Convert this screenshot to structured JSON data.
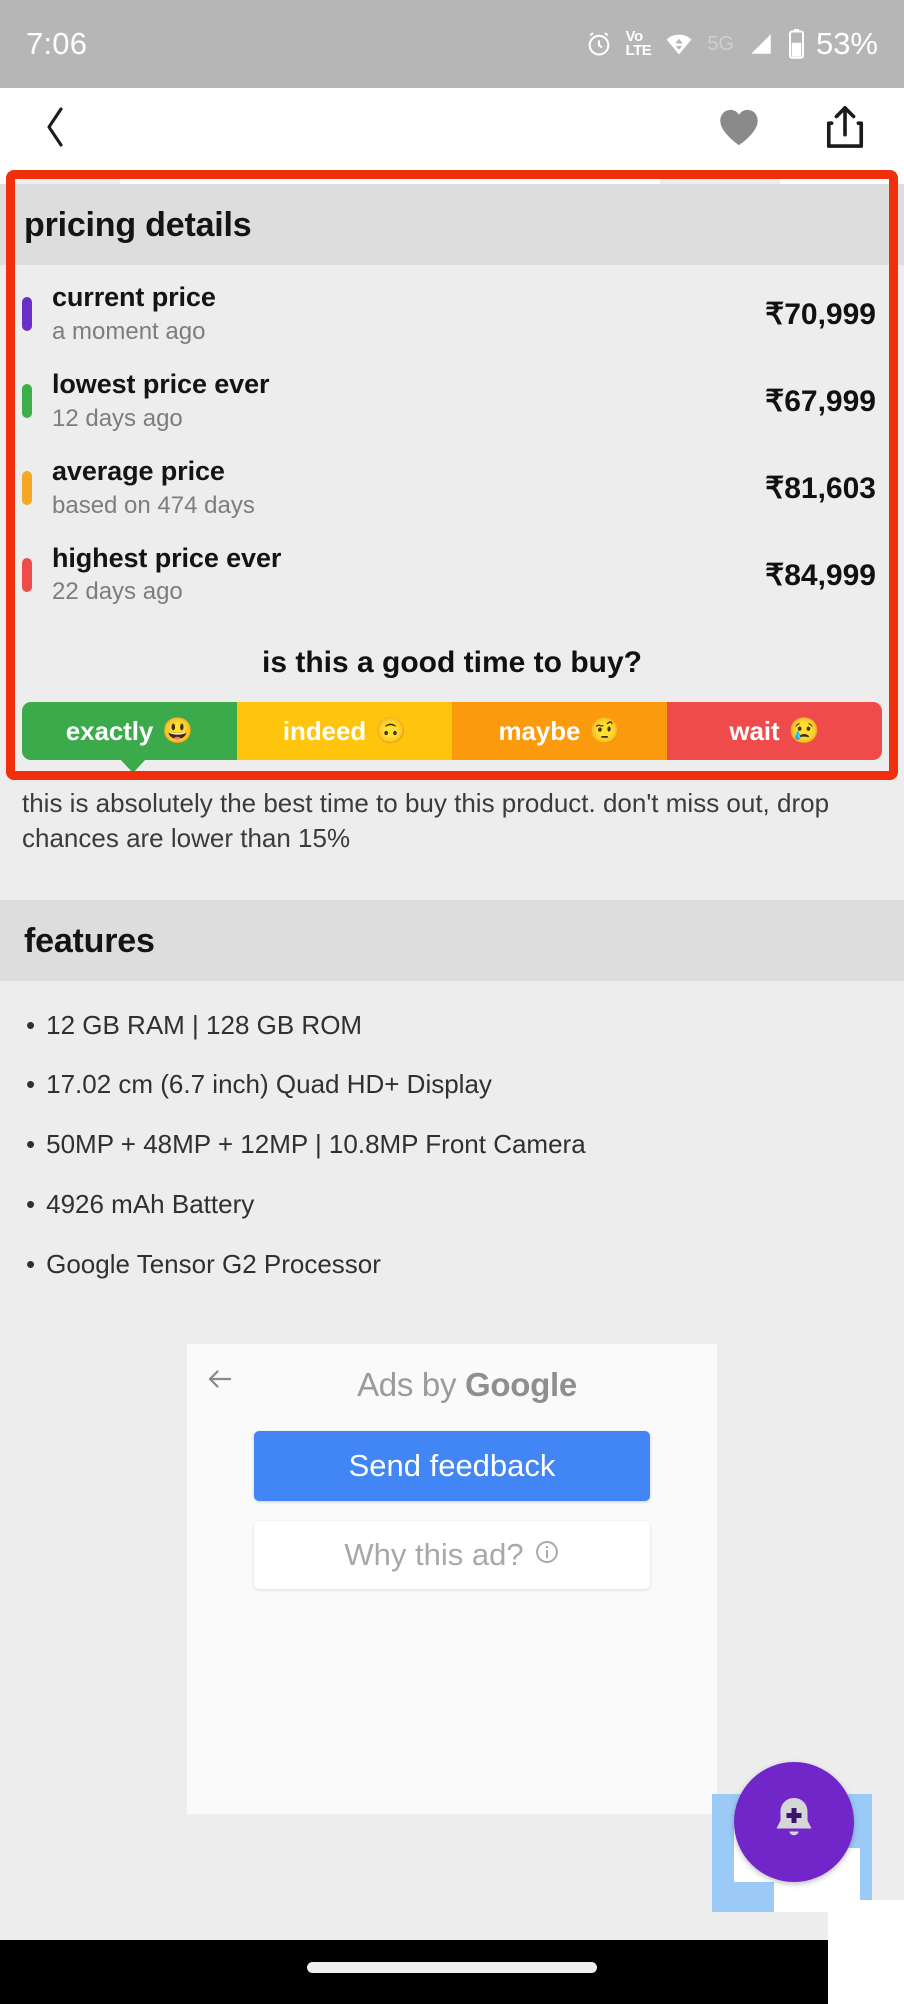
{
  "status_bar": {
    "time": "7:06",
    "network_label_top": "Vo",
    "network_label_bottom": "LTE",
    "mobile_gen": "5G",
    "battery_percent": "53%",
    "icons": [
      "alarm-icon",
      "volte-icon",
      "wifi-icon",
      "signal-icon",
      "battery-icon"
    ]
  },
  "app_bar": {
    "back_icon": "back-chevron-icon",
    "wishlist_icon": "heart-icon",
    "share_icon": "share-icon"
  },
  "pricing": {
    "title": "pricing details",
    "rows": [
      {
        "label": "current price",
        "sub": "a moment ago",
        "amount": "₹70,999",
        "color": "#6A2FC6"
      },
      {
        "label": "lowest price ever",
        "sub": "12 days ago",
        "amount": "₹67,999",
        "color": "#3DAF4A"
      },
      {
        "label": "average price",
        "sub": "based on 474 days",
        "amount": "₹81,603",
        "color": "#F5A623"
      },
      {
        "label": "highest price ever",
        "sub": "22 days ago",
        "amount": "₹84,999",
        "color": "#F04B4B"
      }
    ],
    "question": "is this a good time to buy?",
    "gauge": [
      {
        "label": "exactly",
        "emoji": "😃",
        "color": "#3AAA4A",
        "selected": true
      },
      {
        "label": "indeed",
        "emoji": "🙃",
        "color": "#FFC40C",
        "selected": false
      },
      {
        "label": "maybe",
        "emoji": "🤨",
        "color": "#FB9A0C",
        "selected": false
      },
      {
        "label": "wait",
        "emoji": "😢",
        "color": "#F04B4B",
        "selected": false
      }
    ],
    "verdict": "this is absolutely the best time to buy this product. don't miss out, drop chances are lower than 15%"
  },
  "features": {
    "title": "features",
    "items": [
      "12 GB RAM | 128 GB ROM",
      "17.02 cm (6.7 inch) Quad HD+ Display",
      "50MP + 48MP + 12MP | 10.8MP Front Camera",
      "4926 mAh Battery",
      "Google Tensor G2 Processor"
    ]
  },
  "ad": {
    "back_icon": "back-arrow-icon",
    "label_prefix": "Ads by ",
    "label_brand": "Google",
    "send_feedback": "Send feedback",
    "why_this_ad": "Why this ad?",
    "info_icon": "info-icon"
  },
  "floating": {
    "fab_icon": "bell-add-icon",
    "fab_color": "#7126C9",
    "thumbnail_name": "product-thumbnail"
  },
  "annotation": {
    "highlight_color": "#F22F0C"
  },
  "nav": {
    "gesture_pill": "home-gesture-pill"
  }
}
